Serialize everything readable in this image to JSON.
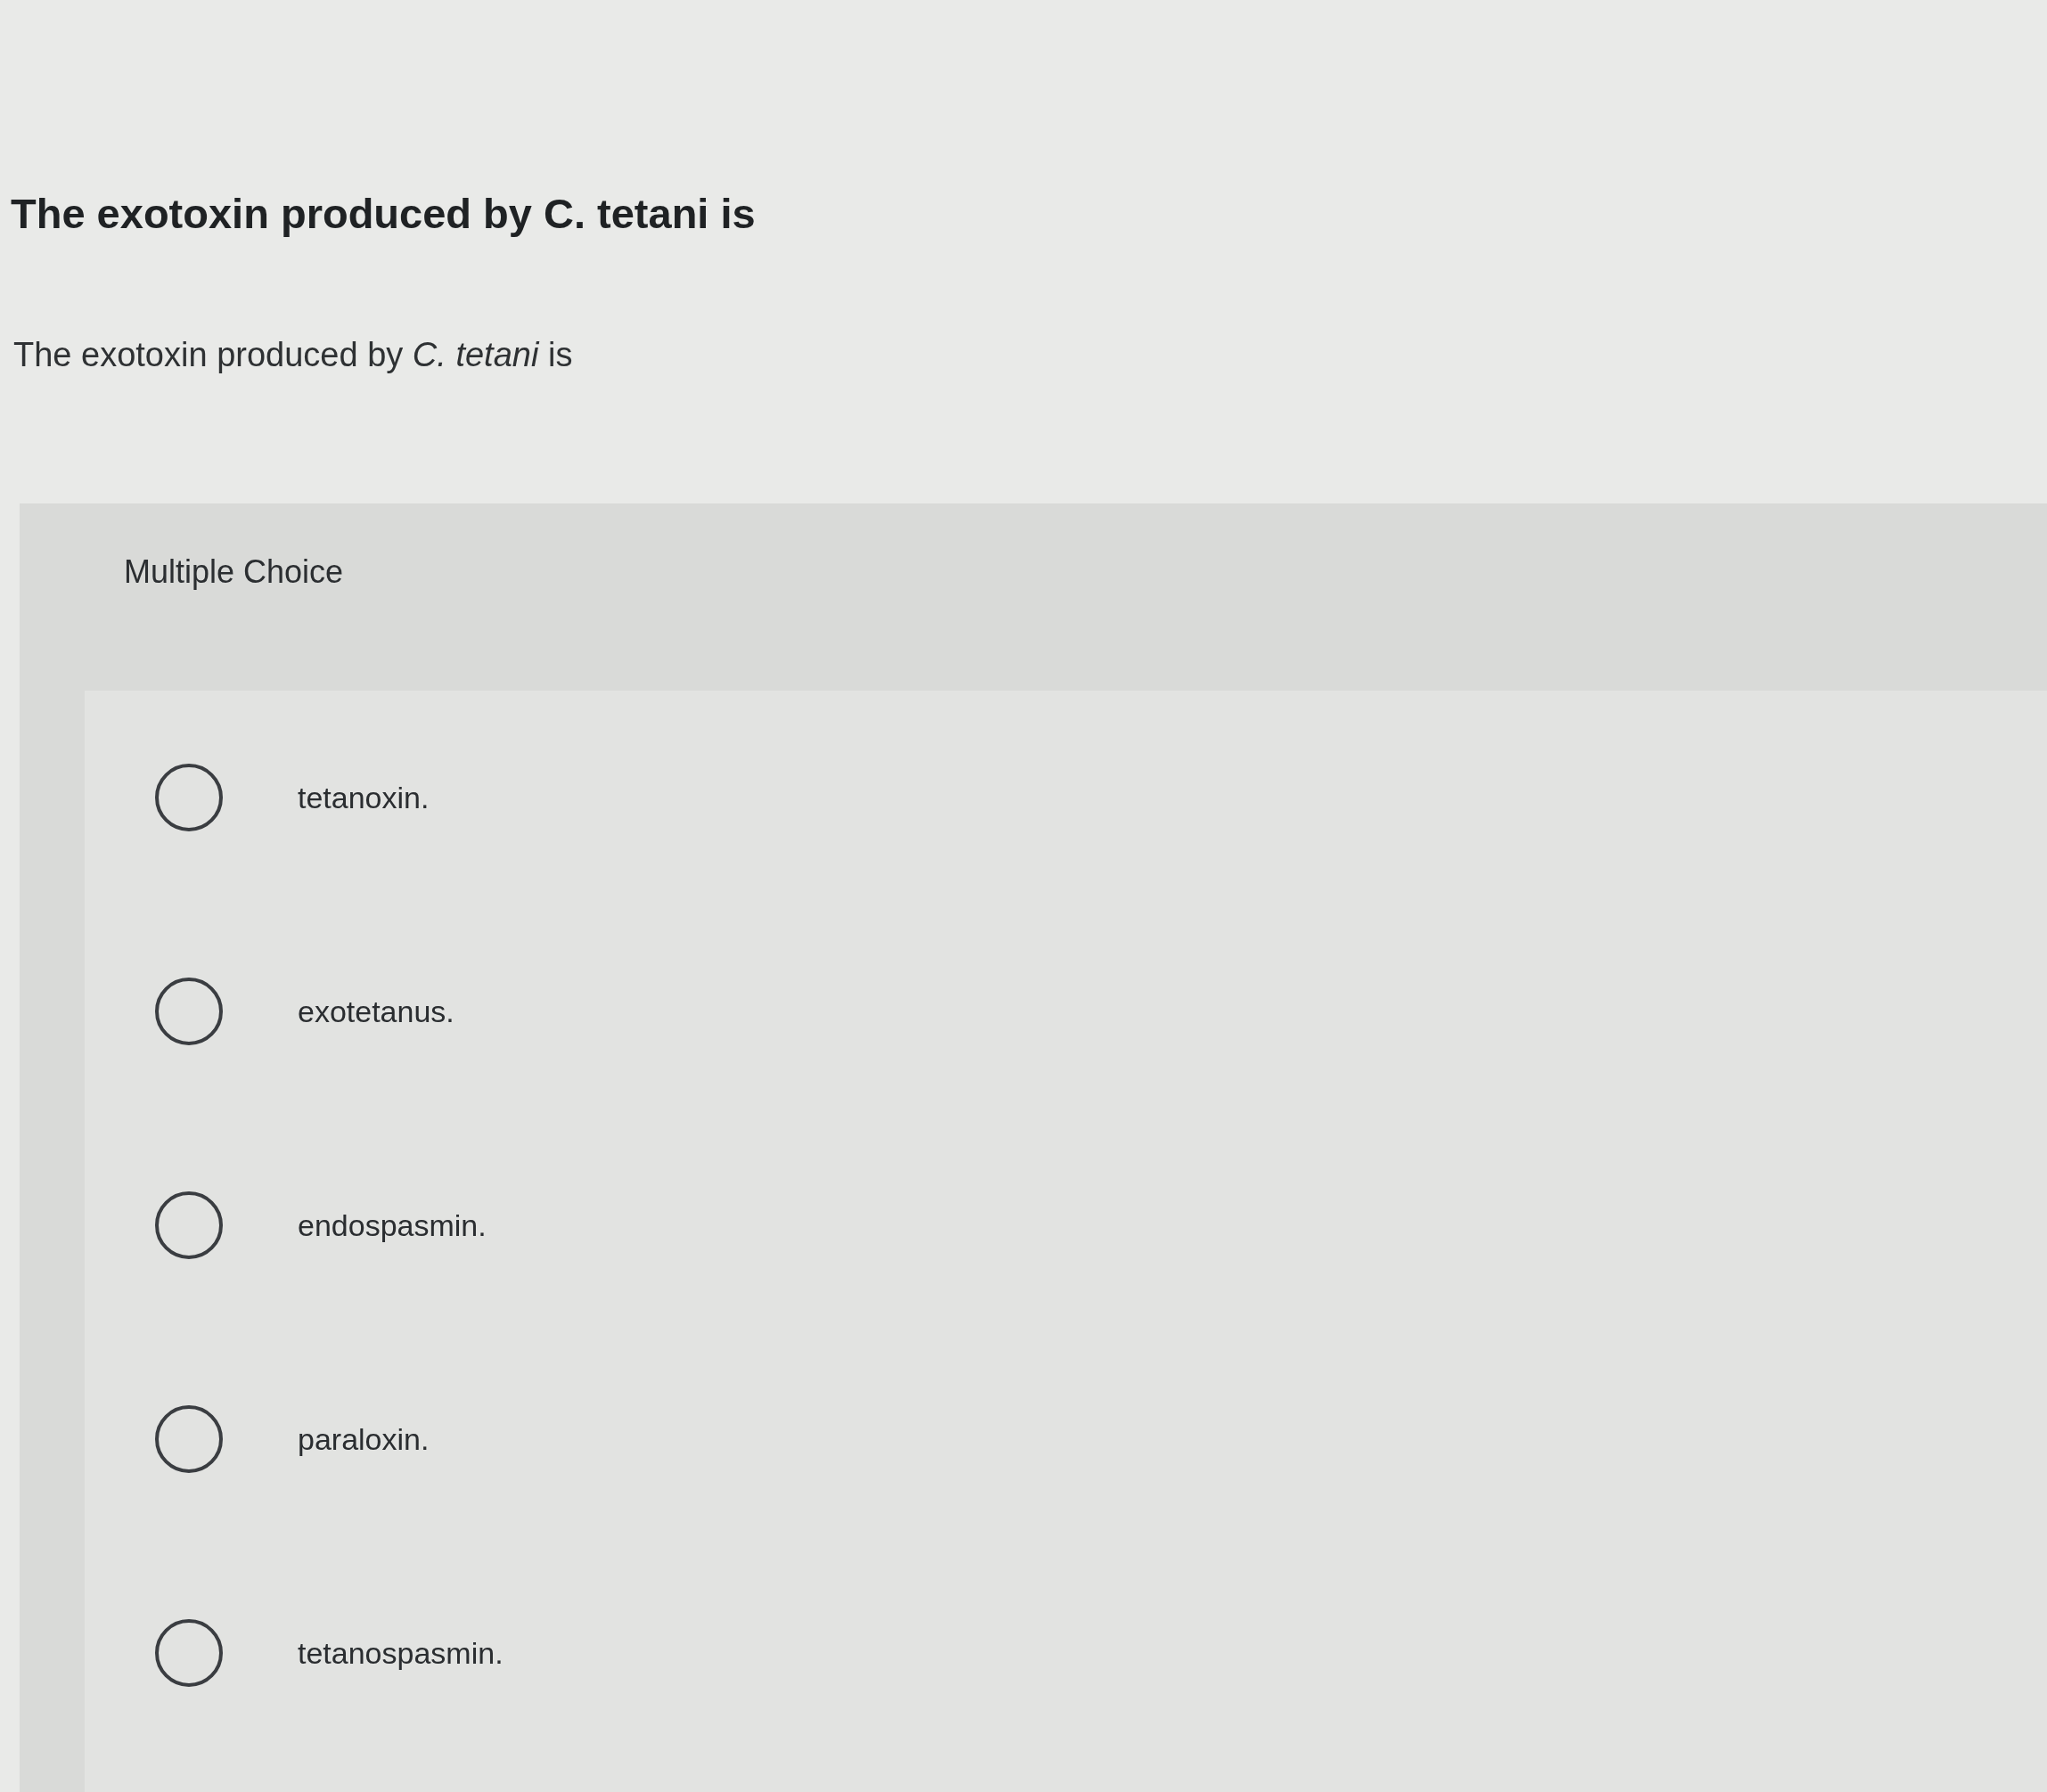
{
  "heading": "The exotoxin produced by C. tetani is",
  "prompt": "The exotoxin produced by *C. tetani* is",
  "question": {
    "type_label": "Multiple Choice",
    "options": [
      {
        "text": "tetanoxin.",
        "selected": false
      },
      {
        "text": "exotetanus.",
        "selected": false
      },
      {
        "text": "endospasmin.",
        "selected": false
      },
      {
        "text": "paraloxin.",
        "selected": false
      },
      {
        "text": "tetanospasmin.",
        "selected": false
      }
    ]
  }
}
